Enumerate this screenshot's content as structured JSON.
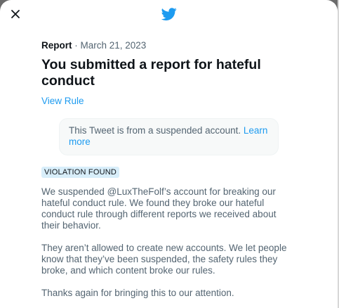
{
  "dialog": {
    "close_label": "×",
    "header_meta_prefix": "Report",
    "header_meta_date": "· March 21, 2023",
    "title": "You submitted a report for hateful conduct",
    "view_rule": "View Rule",
    "suspended_notice": "This Tweet is from a suspended account.",
    "learn_more": "Learn more",
    "badge": "VIOLATION FOUND",
    "paragraphs": [
      "We suspended @LuxTheFolf’s account for breaking our hateful conduct rule. We found they broke our hateful conduct rule through different reports we received about their behavior.",
      "They aren’t allowed to create new accounts. We let people know that they’ve been suspended, the safety rules they broke, and which content broke our rules.",
      "Thanks again for bringing this to our attention."
    ]
  },
  "colors": {
    "brand": "#1d9bf0",
    "text_primary": "#0f1419",
    "text_secondary": "#536471",
    "badge_bg": "#d8eefa"
  },
  "icons": {
    "close": "close-icon",
    "logo": "twitter-bird-icon"
  }
}
